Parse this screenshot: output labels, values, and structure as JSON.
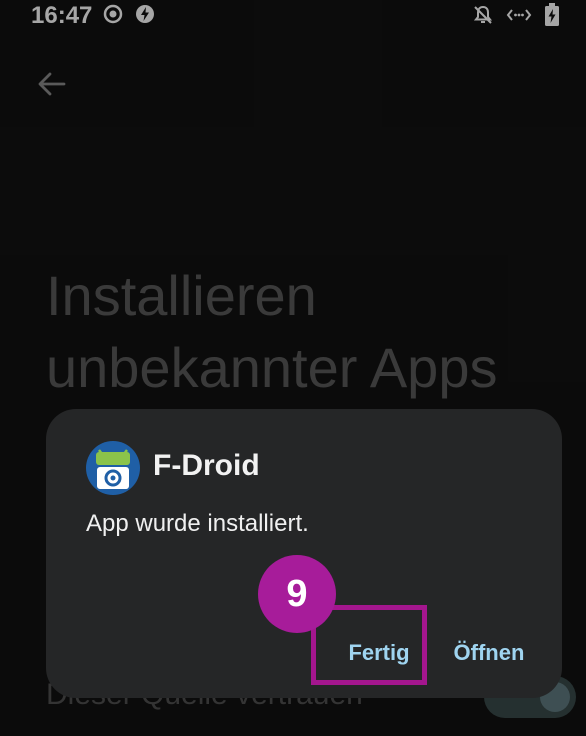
{
  "status_bar": {
    "time": "16:47",
    "left_icons": [
      "record-icon",
      "flash-icon"
    ],
    "right_icons": [
      "notifications-off-icon",
      "data-icon",
      "battery-charging-icon"
    ]
  },
  "header": {
    "back_icon": "arrow-left-icon"
  },
  "page": {
    "title": "Installieren unbekannter Apps",
    "trust_label": "Dieser Quelle vertrauen",
    "trust_toggle_on": true
  },
  "dialog": {
    "app_name": "F-Droid",
    "message": "App wurde installiert.",
    "buttons": {
      "done": "Fertig",
      "open": "Öffnen"
    }
  },
  "annotation": {
    "step_number": "9",
    "color": "#a4168e"
  },
  "colors": {
    "accent": "#9fd4f0",
    "background": "#121212",
    "dialog": "#252627"
  }
}
